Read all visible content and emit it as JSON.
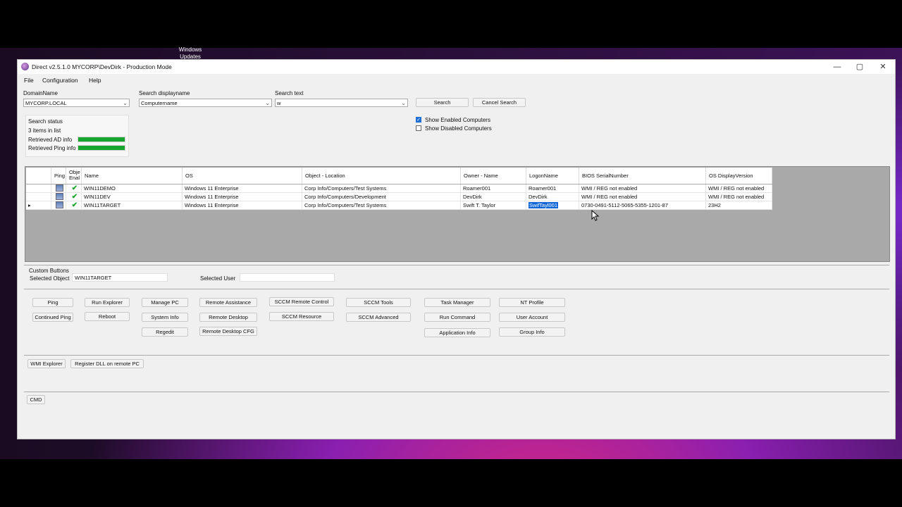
{
  "desktop": {
    "taskbar_label": "Windows Updates"
  },
  "window": {
    "title": "Direct v2.5.1.0 MYCORP\\DevDirk - Production Mode",
    "controls": {
      "minimize": "—",
      "maximize": "▢",
      "close": "✕"
    }
  },
  "menu": {
    "file": "File",
    "configuration": "Configuration",
    "help": "Help"
  },
  "search": {
    "domain_label": "DomainName",
    "domain_value": "MYCORP.LOCAL",
    "display_label": "Search displayname",
    "display_value": "Computername",
    "text_label": "Search text",
    "text_value": "w",
    "search_button": "Search",
    "cancel_button": "Cancel Search",
    "show_enabled": "Show Enabled Computers",
    "show_disabled": "Show Disabled Computers",
    "show_enabled_checked": true,
    "show_disabled_checked": false
  },
  "status": {
    "title": "Search status",
    "items": "3 items in list",
    "ad_info": "Retrieved AD info",
    "ping_info": "Retrieved Ping info",
    "ad_progress": 1.0,
    "ping_progress": 1.0,
    "bar_color": "#17a52e"
  },
  "grid": {
    "columns": [
      "Ping",
      "Obje Enal",
      "Name",
      "OS",
      "Object - Location",
      "Owner - Name",
      "LogonName",
      "BIOS SerialNumber",
      "OS DisplayVersion"
    ],
    "rows": [
      {
        "name": "WIN11DEMO",
        "os": "Windows 11 Enterprise",
        "location": "Corp Info/Computers/Test Systems",
        "owner": "Roamer001",
        "logon": "Roamer001",
        "bios": "WMI / REG not enabled",
        "version": "WMI / REG not enabled"
      },
      {
        "name": "WIN11DEV",
        "os": "Windows 11 Enterprise",
        "location": "Corp Info/Computers/Development",
        "owner": "DevDirk",
        "logon": "DevDirk",
        "bios": "WMI / REG not enabled",
        "version": "WMI / REG not enabled"
      },
      {
        "name": "WIN11TARGET",
        "os": "Windows 11 Enterprise",
        "location": "Corp Info/Computers/Test Systems",
        "owner": "Swift T. Taylor",
        "logon": "SwifTayl001",
        "bios": "0730-0491-5112-5065-5355-1201-87",
        "version": "23H2"
      }
    ],
    "selected_row_marker": "▸",
    "check_glyph": "✔"
  },
  "custom": {
    "title": "Custom Buttons",
    "selected_object_label": "Selected Object",
    "selected_object_value": "WIN11TARGET",
    "selected_user_label": "Selected User",
    "selected_user_value": ""
  },
  "buttons": {
    "ping": "Ping",
    "continued_ping": "Continued Ping",
    "run_explorer": "Run Explorer",
    "reboot": "Reboot",
    "manage_pc": "Manage PC",
    "system_info": "System Info",
    "regedit": "Regedit",
    "remote_assistance": "Remote Assistance",
    "remote_desktop": "Remote Desktop",
    "remote_desktop_cfg": "Remote Desktop CFG",
    "sccm_remote_control": "SCCM Remote Control",
    "sccm_resource": "SCCM Resource",
    "sccm_tools": "SCCM Tools",
    "sccm_advanced": "SCCM Advanced",
    "task_manager": "Task Manager",
    "run_command": "Run Command",
    "application_info": "Application Info",
    "nt_profile": "NT Profile",
    "user_account": "User Account",
    "group_info": "Group Info",
    "wmi_explorer": "WMI Explorer",
    "register_dll": "Register DLL on remote PC",
    "cmd": "CMD"
  }
}
